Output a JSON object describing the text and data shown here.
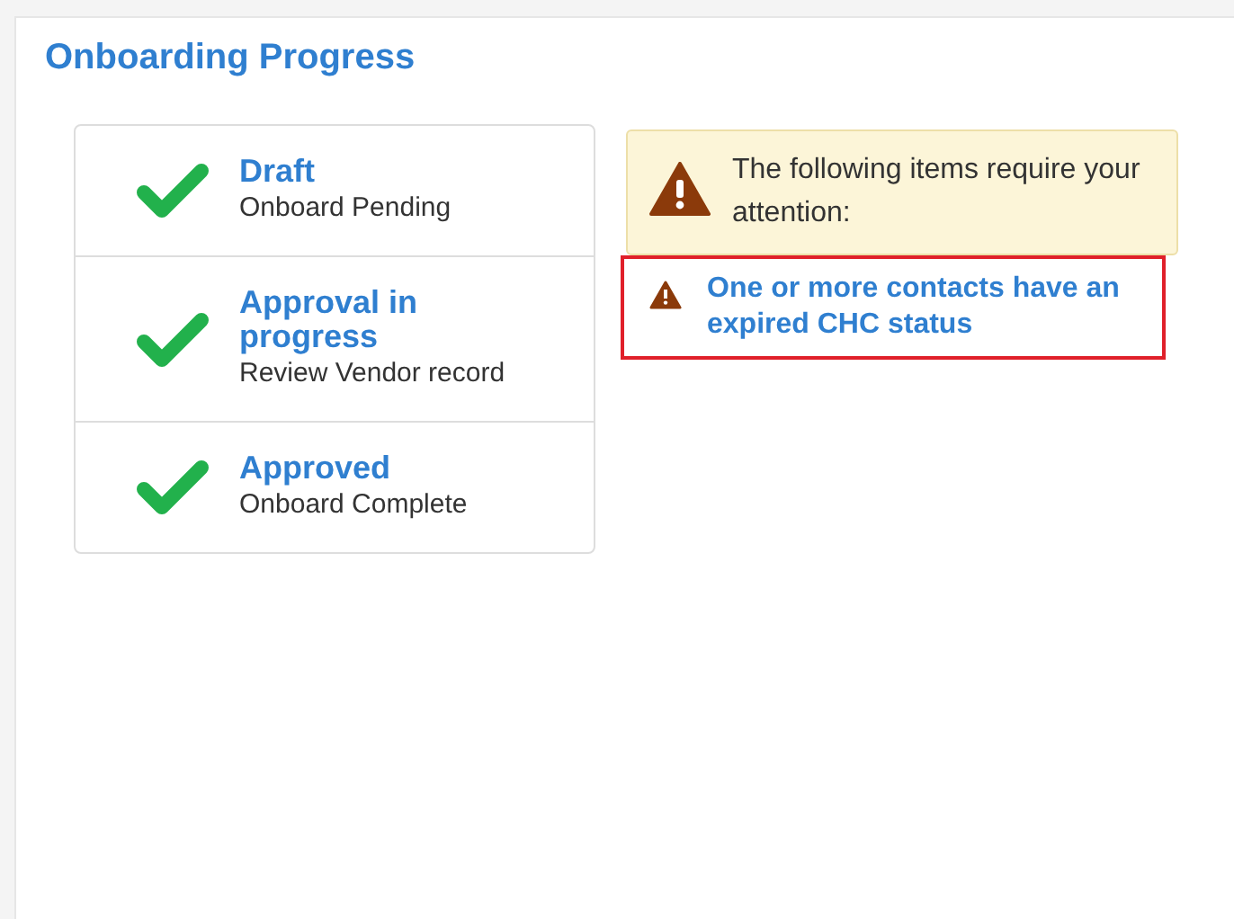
{
  "title": "Onboarding Progress",
  "steps": [
    {
      "title": "Draft",
      "subtitle": "Onboard Pending",
      "completed": true
    },
    {
      "title": "Approval in progress",
      "subtitle": "Review Vendor record",
      "completed": true
    },
    {
      "title": "Approved",
      "subtitle": "Onboard Complete",
      "completed": true
    }
  ],
  "alert": {
    "message": "The following items require your attention:"
  },
  "attention_items": [
    {
      "text": "One or more contacts have an expired CHC status",
      "highlighted": true
    }
  ]
}
